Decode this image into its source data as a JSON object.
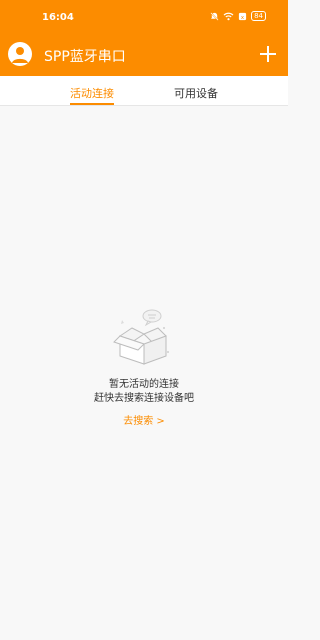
{
  "status_bar": {
    "time": "16:04",
    "battery": "84"
  },
  "app_bar": {
    "title": "SPP蓝牙串口"
  },
  "tabs": [
    {
      "label": "活动连接",
      "active": true
    },
    {
      "label": "可用设备",
      "active": false
    }
  ],
  "empty_state": {
    "line1": "暂无活动的连接",
    "line2": "赶快去搜索连接设备吧",
    "action": "去搜索 >"
  },
  "colors": {
    "accent": "#fc8c00",
    "background": "#f8f8f8"
  },
  "icons": {
    "avatar": "user-icon",
    "add": "plus-icon",
    "mute": "bell-off-icon",
    "wifi": "wifi-icon",
    "sim": "sim-icon"
  }
}
